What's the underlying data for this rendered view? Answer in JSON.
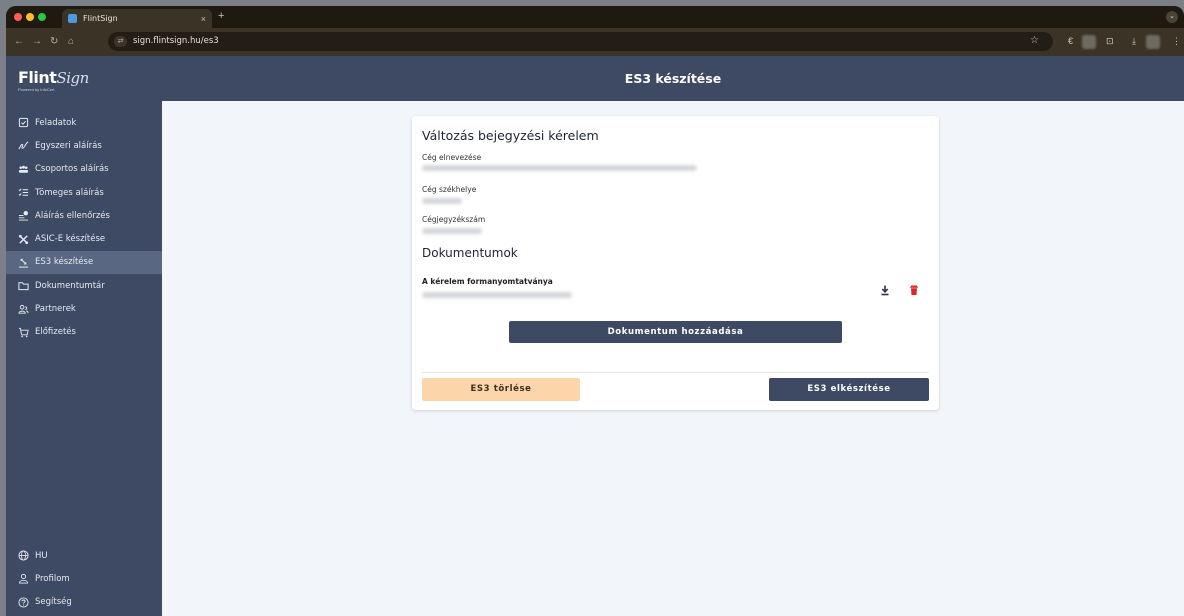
{
  "browser": {
    "tab_title": "FlintSign",
    "tab_close": "×",
    "new_tab": "+",
    "url": "sign.flintsign.hu/es3"
  },
  "app": {
    "logo": "Flint",
    "logo_script": "Sign",
    "logo_sub": "Powered by InfoCert",
    "page_title": "ES3 készítése"
  },
  "sidebar": {
    "items": [
      {
        "label": "Feladatok",
        "icon": "task-check-icon"
      },
      {
        "label": "Egyszeri aláírás",
        "icon": "signature-icon"
      },
      {
        "label": "Csoportos aláírás",
        "icon": "group-icon"
      },
      {
        "label": "Tömeges aláírás",
        "icon": "bulk-list-icon"
      },
      {
        "label": "Aláírás ellenőrzés",
        "icon": "verify-icon"
      },
      {
        "label": "ASIC-E készítése",
        "icon": "asice-icon"
      },
      {
        "label": "ES3 készítése",
        "icon": "es3-icon"
      },
      {
        "label": "Dokumentumtár",
        "icon": "folder-icon"
      },
      {
        "label": "Partnerek",
        "icon": "partners-icon"
      },
      {
        "label": "Előfizetés",
        "icon": "cart-icon"
      }
    ],
    "bottom": [
      {
        "label": "HU",
        "icon": "globe-icon"
      },
      {
        "label": "Profilom",
        "icon": "user-icon"
      },
      {
        "label": "Segítség",
        "icon": "help-icon"
      }
    ]
  },
  "form": {
    "title": "Változás bejegyzési kérelem",
    "company_name_label": "Cég elnevezése",
    "company_seat_label": "Cég székhelye",
    "registry_number_label": "Cégjegyzékszám",
    "documents_title": "Dokumentumok",
    "document_name": "A kérelem formanyomtatványa",
    "add_document": "Dokumentum hozzáadása",
    "delete_es3": "ES3 törlése",
    "create_es3": "ES3 elkészítése"
  },
  "colors": {
    "sidebar_bg": "#3e4a63",
    "active_item": "#5a6782",
    "primary_button": "#3e4a63",
    "danger_soft_button": "#fcd5aa",
    "delete_icon": "#e02424"
  }
}
